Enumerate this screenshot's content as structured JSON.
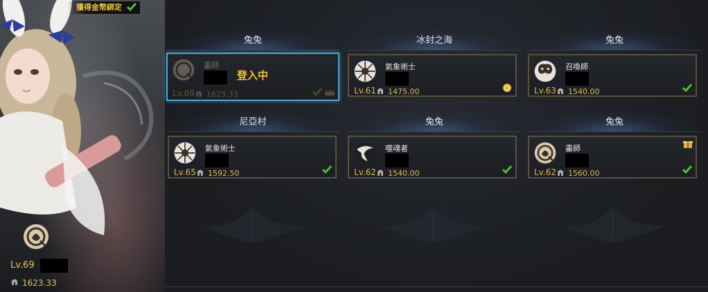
{
  "header": {
    "bind_notice": "獲得金幣綁定"
  },
  "preview": {
    "level": "Lv.69",
    "power": "1623.33",
    "class_icon": "artist-class-icon"
  },
  "slots": [
    {
      "server": "兔兔",
      "class_name": "畫師",
      "class_icon": "artist-class-icon",
      "level": "Lv.69",
      "power": "1623.33",
      "status_text": "登入中",
      "selected": true
    },
    {
      "server": "冰封之海",
      "class_name": "氣象術士",
      "class_icon": "aeromancer-class-icon",
      "level": "Lv.61",
      "power": "1475.00",
      "status_icon": "gold-coin-icon"
    },
    {
      "server": "兔兔",
      "class_name": "召喚師",
      "class_icon": "summoner-class-icon",
      "level": "Lv.63",
      "power": "1540.00",
      "status_icon": "checkmark-icon"
    },
    {
      "server": "尼亞村",
      "class_name": "氣象術士",
      "class_icon": "aeromancer-class-icon",
      "level": "Lv.65",
      "power": "1592.50",
      "status_icon": "checkmark-icon"
    },
    {
      "server": "兔兔",
      "class_name": "噬魂者",
      "class_icon": "souleater-class-icon",
      "level": "Lv.62",
      "power": "1540.00",
      "status_icon": "checkmark-icon"
    },
    {
      "server": "兔兔",
      "class_name": "畫師",
      "class_icon": "artist-class-icon",
      "level": "Lv.62",
      "power": "1560.00",
      "status_icon": "checkmark-icon",
      "extra_icon": "gift-icon"
    }
  ],
  "colors": {
    "accent_gold": "#e2b94f",
    "selected_border": "#4aa8d9",
    "card_border": "#5a5240",
    "check_green": "#4fbf3a"
  }
}
